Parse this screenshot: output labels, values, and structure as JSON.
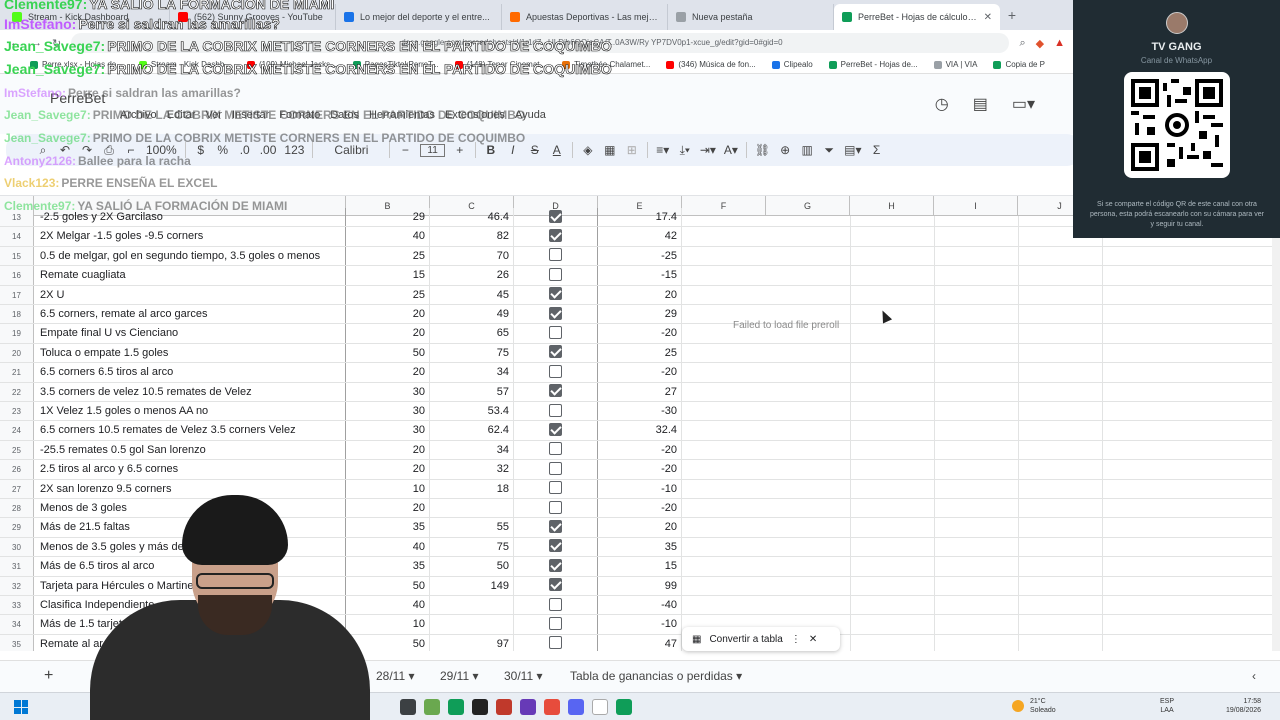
{
  "browser": {
    "tabs": [
      {
        "title": "Stream - Kick Dashboard",
        "color": "#53fc18",
        "active": false
      },
      {
        "title": "(562) Sunny Grooves - YouTube",
        "color": "#ff0000",
        "active": false
      },
      {
        "title": "Lo mejor del deporte y el entre...",
        "color": "#1a73e8",
        "active": false
      },
      {
        "title": "Apuestas Deportivas - Las mejores c...",
        "color": "#ff6a00",
        "active": false
      },
      {
        "title": "Nueva pestaña",
        "color": "#9aa0a6",
        "active": false
      },
      {
        "title": "PerreBet - Hojas de cálculo de G...",
        "color": "#0f9d58",
        "active": true
      }
    ],
    "url": "docs.google.com/spreadsheets/d/1r1d7...ULDib6QQjeCA/T..0A3W/Ry YP7DV0p1-xcue_g/edit?gid=0#gid=0",
    "bookmarks": [
      {
        "label": "Perre.xlsx - Hojas de...",
        "color": "#0f9d58"
      },
      {
        "label": "Stream - Kick Dashb...",
        "color": "#53fc18"
      },
      {
        "label": "(109) Michael Jacks...",
        "color": "#ff0000"
      },
      {
        "label": "PagosTiktokPerreT...",
        "color": "#0f9d58"
      },
      {
        "label": "(148) Tener Cinemat...",
        "color": "#ff0000"
      },
      {
        "label": "Timothée Chalamet...",
        "color": "#e8710a"
      },
      {
        "label": "(346) Música de fon...",
        "color": "#ff0000"
      },
      {
        "label": "Clipealo",
        "color": "#1a73e8"
      },
      {
        "label": "PerreBet - Hojas de...",
        "color": "#0f9d58"
      },
      {
        "label": "VIA | VIA",
        "color": "#9aa0a6"
      },
      {
        "label": "Copia de P",
        "color": "#0f9d58"
      }
    ]
  },
  "sheets": {
    "doc_name": "PerreBet",
    "menus": [
      "Archivo",
      "Editar",
      "Ver",
      "Insertar",
      "Formato",
      "Datos",
      "Herramientas",
      "Extensiones",
      "Ayuda"
    ],
    "toolbar": {
      "zoom": "100%",
      "currency": "$",
      "percent": "%",
      "dec_less": ".0",
      "dec_more": ".00",
      "format123": "123",
      "font": "Calibri",
      "font_size": "11",
      "bold": "B",
      "italic": "I",
      "strike": "S",
      "textcolor": "A"
    },
    "columns": [
      "B",
      "C",
      "D",
      "E",
      "F",
      "G",
      "H",
      "I",
      "J"
    ],
    "rows": [
      {
        "n": "13",
        "a": "-2.5 goles y 2X Garcilaso",
        "b": "29",
        "c": "46.4",
        "d": true,
        "e": "17.4"
      },
      {
        "n": "14",
        "a": "2X Melgar -1.5 goles -9.5 corners",
        "b": "40",
        "c": "82",
        "d": true,
        "e": "42"
      },
      {
        "n": "15",
        "a": "0.5 de melgar, gol en segundo tiempo, 3.5 goles o menos",
        "b": "25",
        "c": "70",
        "d": false,
        "e": "-25"
      },
      {
        "n": "16",
        "a": "Remate cuagliata",
        "b": "15",
        "c": "26",
        "d": false,
        "e": "-15"
      },
      {
        "n": "17",
        "a": "2X U",
        "b": "25",
        "c": "45",
        "d": true,
        "e": "20"
      },
      {
        "n": "18",
        "a": "6.5 corners, remate al arco garces",
        "b": "20",
        "c": "49",
        "d": true,
        "e": "29"
      },
      {
        "n": "19",
        "a": "Empate final U vs Cienciano",
        "b": "20",
        "c": "65",
        "d": false,
        "e": "-20"
      },
      {
        "n": "20",
        "a": "Toluca o empate 1.5 goles",
        "b": "50",
        "c": "75",
        "d": true,
        "e": "25"
      },
      {
        "n": "21",
        "a": "6.5 corners 6.5 tiros al arco",
        "b": "20",
        "c": "34",
        "d": false,
        "e": "-20"
      },
      {
        "n": "22",
        "a": "3.5 corners de velez 10.5 remates de Velez",
        "b": "30",
        "c": "57",
        "d": true,
        "e": "27"
      },
      {
        "n": "23",
        "a": "1X Velez 1.5 goles o menos AA no",
        "b": "30",
        "c": "53.4",
        "d": false,
        "e": "-30"
      },
      {
        "n": "24",
        "a": "6.5 corners 10.5 remates de Velez 3.5 corners Velez",
        "b": "30",
        "c": "62.4",
        "d": true,
        "e": "32.4"
      },
      {
        "n": "25",
        "a": "-25.5 remates 0.5 gol San lorenzo",
        "b": "20",
        "c": "34",
        "d": false,
        "e": "-20"
      },
      {
        "n": "26",
        "a": "2.5 tiros al arco y 6.5 cornes",
        "b": "20",
        "c": "32",
        "d": false,
        "e": "-20"
      },
      {
        "n": "27",
        "a": "2X san lorenzo 9.5 corners",
        "b": "10",
        "c": "18",
        "d": false,
        "e": "-10"
      },
      {
        "n": "28",
        "a": "Menos de 3 goles",
        "b": "20",
        "c": "",
        "d": false,
        "e": "-20"
      },
      {
        "n": "29",
        "a": "Más de 21.5 faltas",
        "b": "35",
        "c": "55",
        "d": true,
        "e": "20"
      },
      {
        "n": "30",
        "a": "Menos de 3.5 goles y más de",
        "b": "40",
        "c": "75",
        "d": true,
        "e": "35"
      },
      {
        "n": "31",
        "a": "Más de 6.5 tiros al arco",
        "b": "35",
        "c": "50",
        "d": true,
        "e": "15"
      },
      {
        "n": "32",
        "a": "Tarjeta para Hércules o Martine",
        "b": "50",
        "c": "149",
        "d": true,
        "e": "99"
      },
      {
        "n": "33",
        "a": "Clasifica Independiente",
        "b": "40",
        "c": "",
        "d": false,
        "e": "-40"
      },
      {
        "n": "34",
        "a": "Más de 1.5 tarjet",
        "b": "10",
        "c": "",
        "d": false,
        "e": "-10"
      },
      {
        "n": "35",
        "a": "Remate al arc",
        "b": "50",
        "c": "97",
        "d": false,
        "e": "47"
      }
    ],
    "failed_msg": "Failed to load file  preroll",
    "convert_label": "Convertir a tabla",
    "sheet_tabs": [
      "28/11",
      "29/11",
      "30/11",
      "Tabla de ganancias o perdidas"
    ]
  },
  "chat": [
    {
      "user": "Clemente97:",
      "text": "YA SALIÓ LA FORMACIÓN DE MIAMI",
      "color": "#39d353",
      "size": "big"
    },
    {
      "user": "ImStefano:",
      "text": "Perre si saldran las amarillas?",
      "color": "#c05cff",
      "size": "big"
    },
    {
      "user": "Jean_Savege7:",
      "text": "PRIMO DE LA COBRIX METISTE CORNERS EN EL PARTIDO DE COQUIMBO",
      "color": "#39d353",
      "size": "big"
    },
    {
      "user": "Jean_Savege7:",
      "text": "PRIMO DE LA COBRIX METISTE CORNERS EN EL PARTIDO DE COQUIMBO",
      "color": "#39d353",
      "size": "big"
    },
    {
      "user": "ImStefano:",
      "text": "Perre si saldran las amarillas?",
      "color": "#c05cff",
      "size": "small"
    },
    {
      "user": "Jean_Savege7:",
      "text": "PRIMO DE LA COBRIX METISTE CORNERS EN EL PARTIDO DE COQUIMBO",
      "color": "#39d353",
      "size": "small"
    },
    {
      "user": "Jean_Savege7:",
      "text": "PRIMO DE LA COBRIX METISTE CORNERS EN EL PARTIDO DE COQUIMBO",
      "color": "#39d353",
      "size": "small"
    },
    {
      "user": "Antony2126:",
      "text": "Ballee para la racha",
      "color": "#c05cff",
      "size": "small"
    },
    {
      "user": "Vlack123:",
      "text": "PERRE ENSEÑA EL EXCEL",
      "color": "#e0a800",
      "size": "small"
    },
    {
      "user": "Clemente97:",
      "text": "YA SALIÓ LA FORMACIÓN DE MIAMI",
      "color": "#39d353",
      "size": "small"
    }
  ],
  "qr_panel": {
    "title": "TV GANG",
    "subtitle": "Canal de WhatsApp",
    "note": "Si se comparte el código QR de este canal con otra persona, esta podrá escanearlo con su cámara para ver y seguir tu canal."
  },
  "taskbar": {
    "weather_temp": "21°C",
    "weather_desc": "Soleado",
    "lang_top": "ESP",
    "lang_bottom": "LAA",
    "time": "17:58",
    "date": "19/08/2026",
    "app_colors": [
      "#3c4043",
      "#6aa84f",
      "#0f9d58",
      "#222222",
      "#c0392b",
      "#673ab7",
      "#e74c3c",
      "#5865f2",
      "#ffffff",
      "#0f9d58"
    ]
  }
}
